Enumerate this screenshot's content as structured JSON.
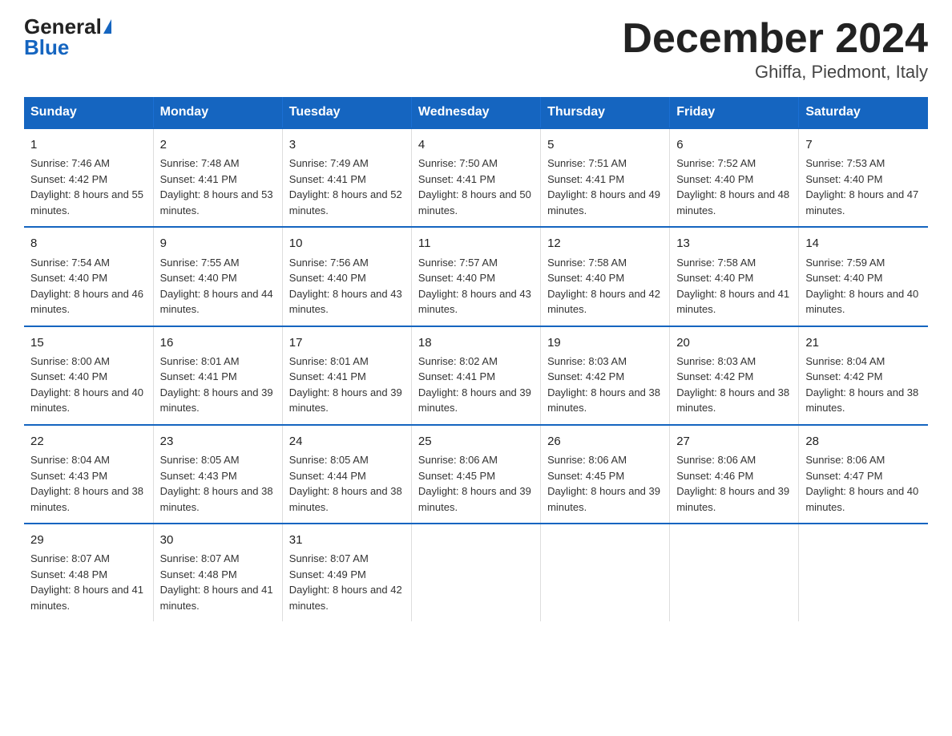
{
  "logo": {
    "general": "General",
    "blue": "Blue"
  },
  "title": "December 2024",
  "subtitle": "Ghiffa, Piedmont, Italy",
  "weekdays": [
    "Sunday",
    "Monday",
    "Tuesday",
    "Wednesday",
    "Thursday",
    "Friday",
    "Saturday"
  ],
  "weeks": [
    [
      {
        "day": "1",
        "sunrise": "7:46 AM",
        "sunset": "4:42 PM",
        "daylight": "8 hours and 55 minutes."
      },
      {
        "day": "2",
        "sunrise": "7:48 AM",
        "sunset": "4:41 PM",
        "daylight": "8 hours and 53 minutes."
      },
      {
        "day": "3",
        "sunrise": "7:49 AM",
        "sunset": "4:41 PM",
        "daylight": "8 hours and 52 minutes."
      },
      {
        "day": "4",
        "sunrise": "7:50 AM",
        "sunset": "4:41 PM",
        "daylight": "8 hours and 50 minutes."
      },
      {
        "day": "5",
        "sunrise": "7:51 AM",
        "sunset": "4:41 PM",
        "daylight": "8 hours and 49 minutes."
      },
      {
        "day": "6",
        "sunrise": "7:52 AM",
        "sunset": "4:40 PM",
        "daylight": "8 hours and 48 minutes."
      },
      {
        "day": "7",
        "sunrise": "7:53 AM",
        "sunset": "4:40 PM",
        "daylight": "8 hours and 47 minutes."
      }
    ],
    [
      {
        "day": "8",
        "sunrise": "7:54 AM",
        "sunset": "4:40 PM",
        "daylight": "8 hours and 46 minutes."
      },
      {
        "day": "9",
        "sunrise": "7:55 AM",
        "sunset": "4:40 PM",
        "daylight": "8 hours and 44 minutes."
      },
      {
        "day": "10",
        "sunrise": "7:56 AM",
        "sunset": "4:40 PM",
        "daylight": "8 hours and 43 minutes."
      },
      {
        "day": "11",
        "sunrise": "7:57 AM",
        "sunset": "4:40 PM",
        "daylight": "8 hours and 43 minutes."
      },
      {
        "day": "12",
        "sunrise": "7:58 AM",
        "sunset": "4:40 PM",
        "daylight": "8 hours and 42 minutes."
      },
      {
        "day": "13",
        "sunrise": "7:58 AM",
        "sunset": "4:40 PM",
        "daylight": "8 hours and 41 minutes."
      },
      {
        "day": "14",
        "sunrise": "7:59 AM",
        "sunset": "4:40 PM",
        "daylight": "8 hours and 40 minutes."
      }
    ],
    [
      {
        "day": "15",
        "sunrise": "8:00 AM",
        "sunset": "4:40 PM",
        "daylight": "8 hours and 40 minutes."
      },
      {
        "day": "16",
        "sunrise": "8:01 AM",
        "sunset": "4:41 PM",
        "daylight": "8 hours and 39 minutes."
      },
      {
        "day": "17",
        "sunrise": "8:01 AM",
        "sunset": "4:41 PM",
        "daylight": "8 hours and 39 minutes."
      },
      {
        "day": "18",
        "sunrise": "8:02 AM",
        "sunset": "4:41 PM",
        "daylight": "8 hours and 39 minutes."
      },
      {
        "day": "19",
        "sunrise": "8:03 AM",
        "sunset": "4:42 PM",
        "daylight": "8 hours and 38 minutes."
      },
      {
        "day": "20",
        "sunrise": "8:03 AM",
        "sunset": "4:42 PM",
        "daylight": "8 hours and 38 minutes."
      },
      {
        "day": "21",
        "sunrise": "8:04 AM",
        "sunset": "4:42 PM",
        "daylight": "8 hours and 38 minutes."
      }
    ],
    [
      {
        "day": "22",
        "sunrise": "8:04 AM",
        "sunset": "4:43 PM",
        "daylight": "8 hours and 38 minutes."
      },
      {
        "day": "23",
        "sunrise": "8:05 AM",
        "sunset": "4:43 PM",
        "daylight": "8 hours and 38 minutes."
      },
      {
        "day": "24",
        "sunrise": "8:05 AM",
        "sunset": "4:44 PM",
        "daylight": "8 hours and 38 minutes."
      },
      {
        "day": "25",
        "sunrise": "8:06 AM",
        "sunset": "4:45 PM",
        "daylight": "8 hours and 39 minutes."
      },
      {
        "day": "26",
        "sunrise": "8:06 AM",
        "sunset": "4:45 PM",
        "daylight": "8 hours and 39 minutes."
      },
      {
        "day": "27",
        "sunrise": "8:06 AM",
        "sunset": "4:46 PM",
        "daylight": "8 hours and 39 minutes."
      },
      {
        "day": "28",
        "sunrise": "8:06 AM",
        "sunset": "4:47 PM",
        "daylight": "8 hours and 40 minutes."
      }
    ],
    [
      {
        "day": "29",
        "sunrise": "8:07 AM",
        "sunset": "4:48 PM",
        "daylight": "8 hours and 41 minutes."
      },
      {
        "day": "30",
        "sunrise": "8:07 AM",
        "sunset": "4:48 PM",
        "daylight": "8 hours and 41 minutes."
      },
      {
        "day": "31",
        "sunrise": "8:07 AM",
        "sunset": "4:49 PM",
        "daylight": "8 hours and 42 minutes."
      },
      null,
      null,
      null,
      null
    ]
  ]
}
